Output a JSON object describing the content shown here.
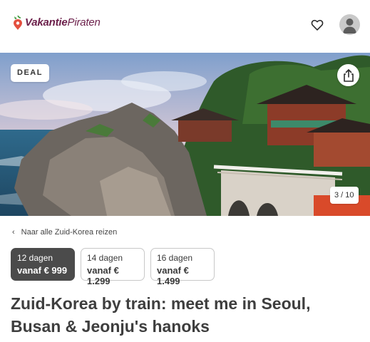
{
  "header": {
    "logo_text_bold": "Vakantie",
    "logo_text_light": "Piraten",
    "brand_color": "#6b1f4a",
    "favorite_icon": "heart-outline-icon",
    "profile_icon": "user-avatar-icon"
  },
  "hero": {
    "deal_label": "DEAL",
    "share_icon": "share-icon",
    "image_counter": "3 / 10"
  },
  "navigation": {
    "back_icon": "chevron-left-icon",
    "back_label": "Naar alle Zuid-Korea reizen"
  },
  "duration_options": [
    {
      "days": "12 dagen",
      "price": "vanaf € 999",
      "selected": true
    },
    {
      "days": "14 dagen",
      "price": "vanaf € 1.299",
      "selected": false
    },
    {
      "days": "16 dagen",
      "price": "vanaf € 1.499",
      "selected": false
    }
  ],
  "trip": {
    "title": "Zuid-Korea by train: meet me in Seoul, Busan & Jeonju's hanoks"
  }
}
